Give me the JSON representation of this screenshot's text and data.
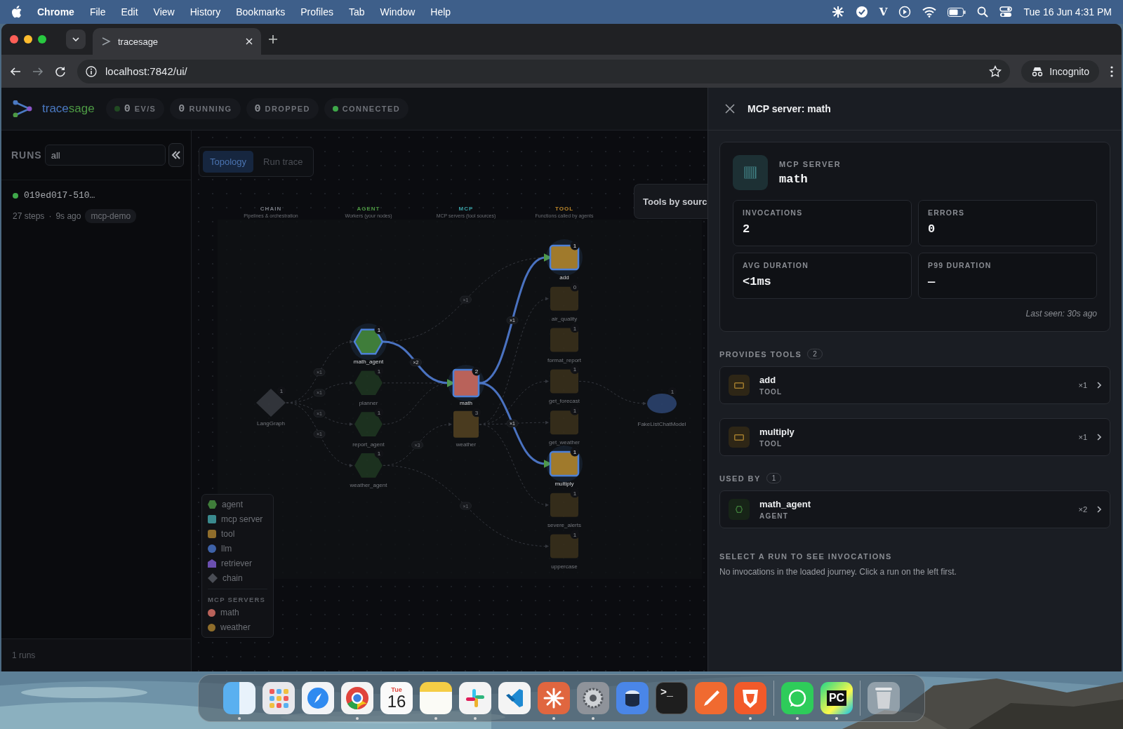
{
  "menu_bar": {
    "app": "Chrome",
    "menus": [
      "File",
      "Edit",
      "View",
      "History",
      "Bookmarks",
      "Profiles",
      "Tab",
      "Window",
      "Help"
    ],
    "status": [
      {
        "kind": "sparkle"
      },
      {
        "kind": "check"
      },
      {
        "kind": "letter",
        "text": "V"
      },
      {
        "kind": "play"
      },
      {
        "kind": "wifi"
      },
      {
        "kind": "battery"
      },
      {
        "kind": "search"
      },
      {
        "kind": "toggles"
      }
    ],
    "clock": "Tue 16 Jun  4:31 PM"
  },
  "browser": {
    "tab_title": "tracesage",
    "url": "localhost:7842/ui/",
    "profile": "Incognito"
  },
  "header": {
    "brand_prefix": "trace",
    "brand_suffix": "sage",
    "stats": [
      {
        "kind": "rate",
        "value": "0",
        "label": "EV/S"
      },
      {
        "kind": "counter",
        "value": "0",
        "label": "RUNNING"
      },
      {
        "kind": "counter",
        "value": "0",
        "label": "DROPPED"
      },
      {
        "kind": "connection",
        "label": "CONNECTED"
      }
    ]
  },
  "sidebar": {
    "title": "RUNS",
    "filter": "all",
    "runs": [
      {
        "id": "019ed017-510…",
        "live": true,
        "steps": "27 steps",
        "separator": "·",
        "age": "9s ago",
        "tag": "mcp-demo"
      }
    ],
    "footer": "1 runs"
  },
  "view_tabs": [
    {
      "label": "Topology",
      "selected": true
    },
    {
      "label": "Run trace",
      "selected": false
    }
  ],
  "graph": {
    "columns": [
      {
        "kind": "chain",
        "title": "CHAIN",
        "subtitle": "Pipelines & orchestration"
      },
      {
        "kind": "agent",
        "title": "AGENT",
        "subtitle": "Workers (your nodes)"
      },
      {
        "kind": "mcp",
        "title": "MCP",
        "subtitle": "MCP servers (tool sources)"
      },
      {
        "kind": "tool",
        "title": "TOOL",
        "subtitle": "Functions called by agents"
      }
    ],
    "nodes": [
      {
        "kind": "chain",
        "label": "LangGraph",
        "count": "1",
        "highlighted": false
      },
      {
        "kind": "agent",
        "label": "math_agent",
        "count": "1",
        "highlighted": true
      },
      {
        "kind": "agent",
        "label": "planner",
        "count": "1",
        "highlighted": false
      },
      {
        "kind": "agent",
        "label": "report_agent",
        "count": "1",
        "highlighted": false
      },
      {
        "kind": "agent",
        "label": "weather_agent",
        "count": "1",
        "highlighted": false
      },
      {
        "kind": "mcp",
        "label": "math",
        "count": "2",
        "highlighted": true,
        "color": "#b9625a"
      },
      {
        "kind": "mcp",
        "label": "weather",
        "count": "3",
        "highlighted": false,
        "color": "#4a3b1f"
      },
      {
        "kind": "tool",
        "label": "add",
        "count": "1",
        "highlighted": true
      },
      {
        "kind": "tool",
        "label": "air_quality",
        "count": "0",
        "highlighted": false
      },
      {
        "kind": "tool",
        "label": "format_report",
        "count": "1",
        "highlighted": false
      },
      {
        "kind": "tool",
        "label": "get_forecast",
        "count": "1",
        "highlighted": false
      },
      {
        "kind": "tool",
        "label": "get_weather",
        "count": "1",
        "highlighted": false
      },
      {
        "kind": "tool",
        "label": "multiply",
        "count": "1",
        "highlighted": true
      },
      {
        "kind": "tool",
        "label": "severe_alerts",
        "count": "1",
        "highlighted": false
      },
      {
        "kind": "tool",
        "label": "uppercase",
        "count": "1",
        "highlighted": false
      },
      {
        "kind": "llm",
        "label": "FakeListChatModel",
        "count": "1",
        "highlighted": false
      }
    ],
    "edges": [
      {
        "label": "×1",
        "active": false
      },
      {
        "label": "×1",
        "active": false
      },
      {
        "label": "×1",
        "active": false
      },
      {
        "label": "×1",
        "active": false
      },
      {
        "label": "×1",
        "active": false
      },
      {
        "active": false
      },
      {
        "active": false
      },
      {
        "label": "×3",
        "active": false
      },
      {
        "label": "×1",
        "active": false
      },
      {
        "active": false
      },
      {
        "active": false
      },
      {
        "active": false
      },
      {
        "active": false
      },
      {
        "active": false
      },
      {
        "label": "×2",
        "active": true
      },
      {
        "label": "×1",
        "active": true
      },
      {
        "label": "×1",
        "active": true
      }
    ],
    "popup": {
      "title": "Tools by sourc"
    }
  },
  "legend": {
    "items": [
      {
        "kind": "agent",
        "label": "agent"
      },
      {
        "kind": "mcp",
        "label": "mcp server"
      },
      {
        "kind": "tool",
        "label": "tool"
      },
      {
        "kind": "llm",
        "label": "llm"
      },
      {
        "kind": "retriever",
        "label": "retriever"
      },
      {
        "kind": "chain",
        "label": "chain"
      }
    ],
    "servers_title": "MCP SERVERS",
    "servers": [
      {
        "label": "math",
        "color": "#b9625a"
      },
      {
        "label": "weather",
        "color": "#8f6d2b"
      }
    ]
  },
  "panel": {
    "title": "MCP server: math",
    "kind_label": "MCP SERVER",
    "name": "math",
    "stats": [
      {
        "label": "INVOCATIONS",
        "value": "2"
      },
      {
        "label": "ERRORS",
        "value": "0"
      },
      {
        "label": "AVG DURATION",
        "value": "<1ms"
      },
      {
        "label": "P99 DURATION",
        "value": "—"
      }
    ],
    "last_seen": "Last seen: 30s ago",
    "sections": [
      {
        "title": "PROVIDES TOOLS",
        "count": "2",
        "items": [
          {
            "kind": "tool",
            "name": "add",
            "type": "TOOL",
            "calls": "×1"
          },
          {
            "kind": "tool",
            "name": "multiply",
            "type": "TOOL",
            "calls": "×1"
          }
        ]
      },
      {
        "title": "USED BY",
        "count": "1",
        "items": [
          {
            "kind": "agent",
            "name": "math_agent",
            "type": "AGENT",
            "calls": "×2"
          }
        ]
      }
    ],
    "empty_title": "SELECT A RUN TO SEE INVOCATIONS",
    "empty_text": "No invocations in the loaded journey. Click a run on the left first."
  },
  "dock": [
    {
      "kind": "finder",
      "running": true
    },
    {
      "kind": "grid",
      "running": false
    },
    {
      "kind": "compass",
      "running": false
    },
    {
      "kind": "ring",
      "running": true
    },
    {
      "kind": "calendar",
      "text": "Tue",
      "number": "16",
      "running": false
    },
    {
      "kind": "notes",
      "running": true
    },
    {
      "kind": "pinwheel",
      "running": true
    },
    {
      "kind": "ribbon",
      "running": false
    },
    {
      "kind": "sparkle",
      "running": true
    },
    {
      "kind": "gear",
      "running": true
    },
    {
      "kind": "disk",
      "running": false
    },
    {
      "kind": "terminal",
      "text": ">_",
      "running": false
    },
    {
      "kind": "pen",
      "running": false
    },
    {
      "kind": "shield",
      "running": true
    },
    {
      "kind": "divider"
    },
    {
      "kind": "chat",
      "running": true
    },
    {
      "kind": "ide",
      "text": "PC",
      "running": true
    },
    {
      "kind": "divider"
    },
    {
      "kind": "trash",
      "running": false
    }
  ]
}
